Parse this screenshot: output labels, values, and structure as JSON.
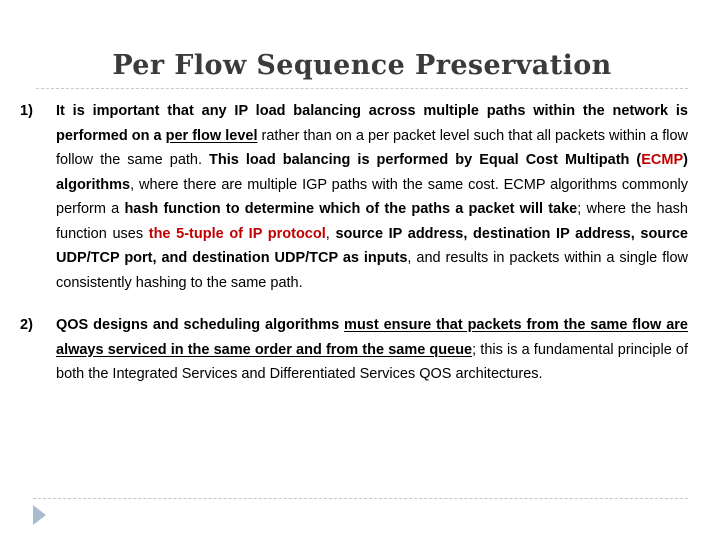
{
  "slide": {
    "title": "Per Flow Sequence Preservation",
    "title_color": "#3b3b3b",
    "accent_red": "#c00000",
    "footer_arrow_color": "#a9bbce",
    "rule_color": "#c9c9c9",
    "background": "#ffffff"
  },
  "points": [
    {
      "marker": "1)",
      "segments": [
        {
          "text": "It is important that any IP load balancing across multiple paths within the network is performed on a ",
          "bold": true
        },
        {
          "text": "per flow level",
          "bold": true,
          "underline": true
        },
        {
          "text": " rather than on a per packet level such that all packets within a flow follow the same path. ",
          "bold": false
        },
        {
          "text": "This load balancing is performed by Equal Cost Multipath (",
          "bold": true
        },
        {
          "text": "ECMP",
          "bold": true,
          "color": "#c00000"
        },
        {
          "text": ") algorithms",
          "bold": true
        },
        {
          "text": ", where there are multiple IGP paths with the same cost. ECMP algorithms commonly perform a ",
          "bold": false
        },
        {
          "text": "hash function to determine which of the paths a packet will take",
          "bold": true
        },
        {
          "text": "; where the hash function uses ",
          "bold": false
        },
        {
          "text": "the 5-tuple of IP protocol",
          "bold": true,
          "color": "#c00000"
        },
        {
          "text": ", ",
          "bold": false
        },
        {
          "text": "source IP address, destination IP address, source UDP/TCP port, and destination UDP/TCP as inputs",
          "bold": true
        },
        {
          "text": ", and results in packets within a single flow consistently hashing to the same path.",
          "bold": false
        }
      ]
    },
    {
      "marker": "2)",
      "segments": [
        {
          "text": "QOS designs and scheduling algorithms ",
          "bold": true
        },
        {
          "text": "must ensure that packets from the same flow are always serviced in the same order and from the same queue",
          "bold": true,
          "underline": true
        },
        {
          "text": "; this is a fundamental principle of both the Integrated Services and Differentiated Services QOS architectures.",
          "bold": false
        }
      ]
    }
  ],
  "footer": {
    "arrow_icon": "play-triangle-icon",
    "divider": "dashed-rule"
  }
}
